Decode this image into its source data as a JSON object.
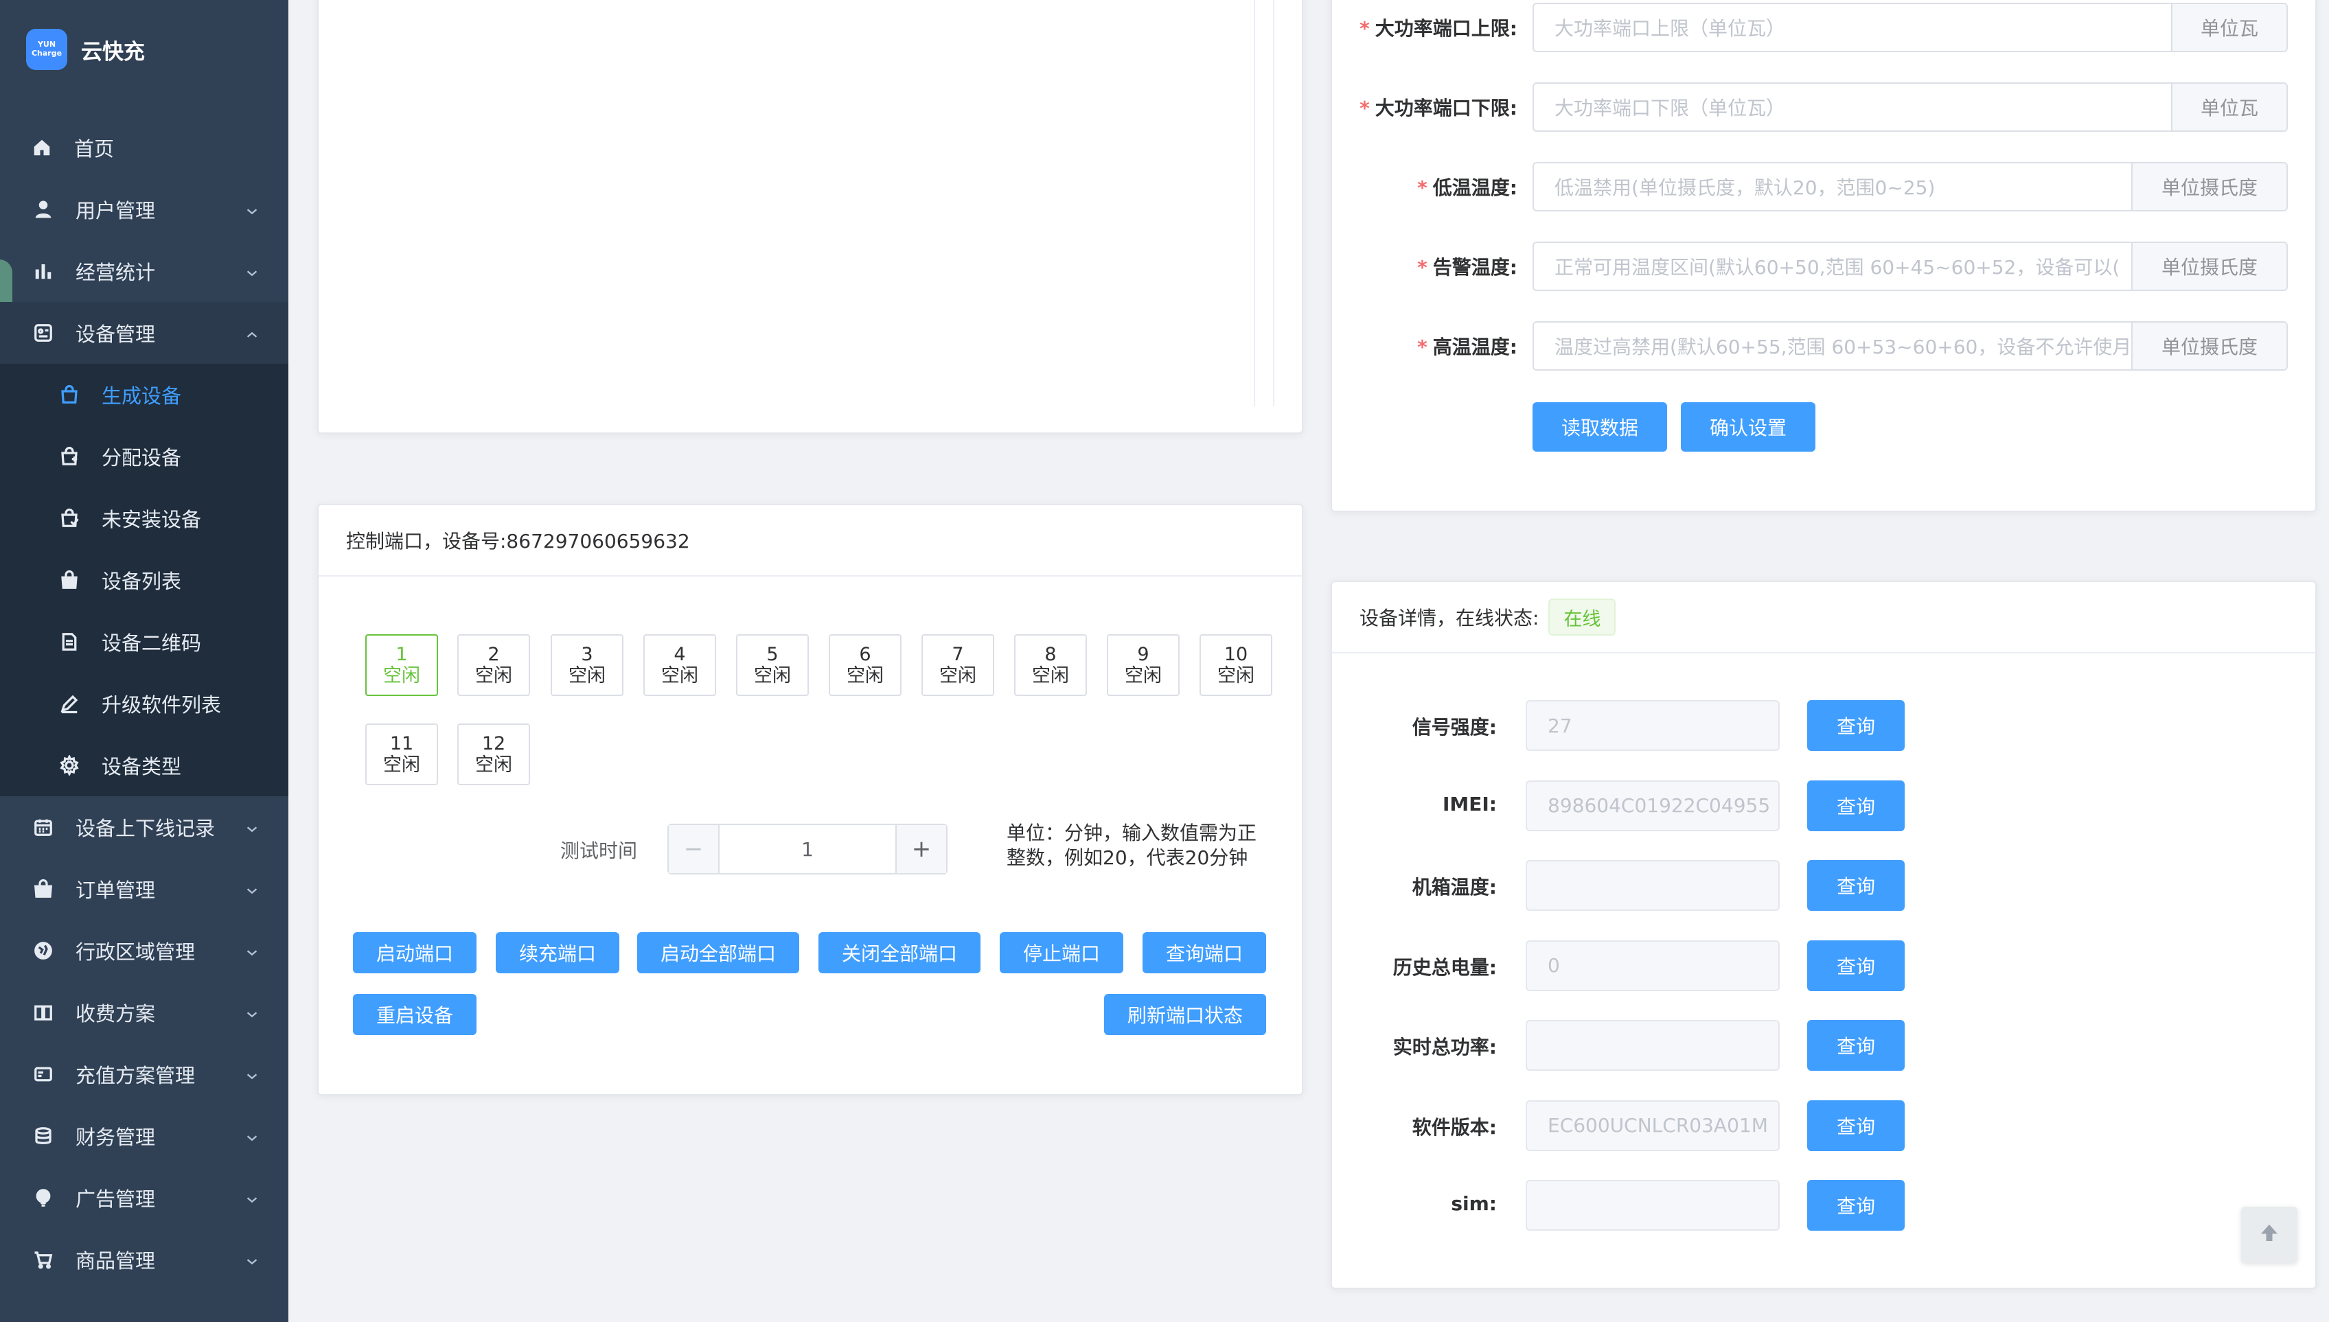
{
  "app": {
    "name": "云快充",
    "logo_text_top": "YUN",
    "logo_text_bottom": "Charge"
  },
  "sidebar": {
    "home": "首页",
    "items": [
      {
        "label": "用户管理",
        "icon": "user-icon"
      },
      {
        "label": "经营统计",
        "icon": "bar-chart-icon"
      },
      {
        "label": "设备管理",
        "icon": "device-icon",
        "open": true
      },
      {
        "label": "设备上下线记录",
        "icon": "calendar-icon"
      },
      {
        "label": "订单管理",
        "icon": "bag-icon"
      },
      {
        "label": "行政区域管理",
        "icon": "globe-icon"
      },
      {
        "label": "收费方案",
        "icon": "book-icon"
      },
      {
        "label": "充值方案管理",
        "icon": "card-icon"
      },
      {
        "label": "财务管理",
        "icon": "coins-icon"
      },
      {
        "label": "广告管理",
        "icon": "bulb-icon"
      },
      {
        "label": "商品管理",
        "icon": "cart-icon"
      }
    ],
    "sub_items": [
      {
        "label": "生成设备",
        "active": true
      },
      {
        "label": "分配设备"
      },
      {
        "label": "未安装设备"
      },
      {
        "label": "设备列表"
      },
      {
        "label": "设备二维码"
      },
      {
        "label": "升级软件列表"
      },
      {
        "label": "设备类型"
      }
    ]
  },
  "settings_form": {
    "fields": [
      {
        "label": "大功率端口上限:",
        "placeholder": "大功率端口上限（单位瓦）",
        "unit": "单位瓦"
      },
      {
        "label": "大功率端口下限:",
        "placeholder": "大功率端口下限（单位瓦）",
        "unit": "单位瓦"
      },
      {
        "label": "低温温度:",
        "placeholder": "低温禁用(单位摄氏度，默认20，范围0~25)",
        "unit": "单位摄氏度"
      },
      {
        "label": "告警温度:",
        "placeholder": "正常可用温度区间(默认60+50,范围 60+45~60+52，设备可以(",
        "unit": "单位摄氏度"
      },
      {
        "label": "高温温度:",
        "placeholder": "温度过高禁用(默认60+55,范围 60+53~60+60，设备不允许使月",
        "unit": "单位摄氏度"
      }
    ],
    "read_button": "读取数据",
    "confirm_button": "确认设置"
  },
  "port_control": {
    "title": "控制端口，设备号:867297060659632",
    "ports": [
      {
        "num": "1",
        "status": "空闲"
      },
      {
        "num": "2",
        "status": "空闲"
      },
      {
        "num": "3",
        "status": "空闲"
      },
      {
        "num": "4",
        "status": "空闲"
      },
      {
        "num": "5",
        "status": "空闲"
      },
      {
        "num": "6",
        "status": "空闲"
      },
      {
        "num": "7",
        "status": "空闲"
      },
      {
        "num": "8",
        "status": "空闲"
      },
      {
        "num": "9",
        "status": "空闲"
      },
      {
        "num": "10",
        "status": "空闲"
      },
      {
        "num": "11",
        "status": "空闲"
      },
      {
        "num": "12",
        "status": "空闲"
      }
    ],
    "test_time_label": "测试时间",
    "test_time_value": "1",
    "unit_hint_line1": "单位：分钟，输入数值需为正",
    "unit_hint_line2": "整数，例如20，代表20分钟",
    "buttons": {
      "start": "启动端口",
      "renew": "续充端口",
      "start_all": "启动全部端口",
      "close_all": "关闭全部端口",
      "stop": "停止端口",
      "query": "查询端口",
      "reboot": "重启设备",
      "refresh": "刷新端口状态"
    }
  },
  "device_detail": {
    "title": "设备详情，在线状态:",
    "status": "在线",
    "rows": [
      {
        "label": "信号强度:",
        "value": "27",
        "button": "查询"
      },
      {
        "label": "IMEI:",
        "value": "898604C01922C04955",
        "button": "查询"
      },
      {
        "label": "机箱温度:",
        "value": "",
        "button": "查询"
      },
      {
        "label": "历史总电量:",
        "value": "0",
        "button": "查询"
      },
      {
        "label": "实时总功率:",
        "value": "",
        "button": "查询"
      },
      {
        "label": "软件版本:",
        "value": "EC600UCNLCR03A01M",
        "button": "查询"
      },
      {
        "label": "sim:",
        "value": "",
        "button": "查询"
      }
    ]
  },
  "colors": {
    "primary": "#409eff",
    "sidebar_bg": "#304156",
    "success": "#67c23a"
  }
}
